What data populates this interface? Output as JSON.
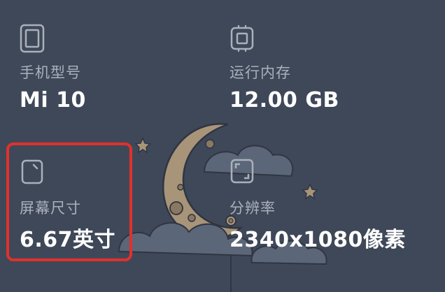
{
  "specs": [
    {
      "icon": "phone-icon",
      "label": "手机型号",
      "value": "Mi 10"
    },
    {
      "icon": "memory-chip-icon",
      "label": "运行内存",
      "value": "12.00 GB"
    },
    {
      "icon": "screen-size-icon",
      "label": "屏幕尺寸",
      "value": "6.67英寸"
    },
    {
      "icon": "resolution-icon",
      "label": "分辨率",
      "value": "2340x1080像素"
    }
  ],
  "highlight": {
    "target": "screen-size",
    "color": "#e0312b"
  },
  "colors": {
    "background": "#3f4858",
    "label": "#aab1bc",
    "value": "#ffffff",
    "moon": "#a89478"
  }
}
